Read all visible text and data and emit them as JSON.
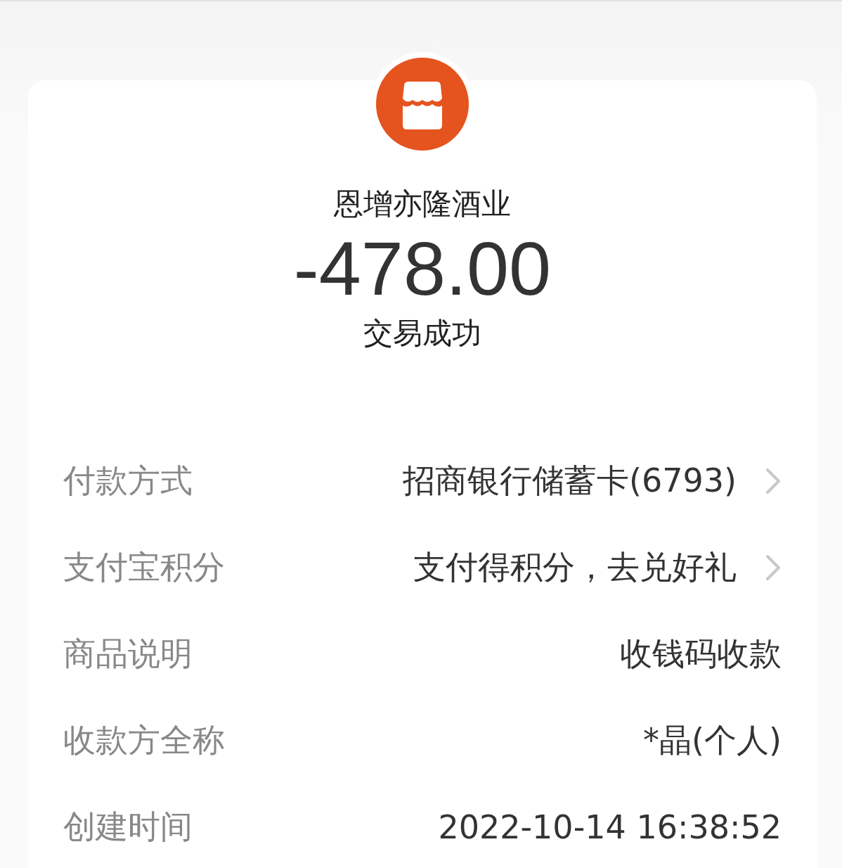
{
  "merchant": {
    "name": "恩增亦隆酒业",
    "amount": "-478.00",
    "status": "交易成功"
  },
  "details": [
    {
      "label": "付款方式",
      "value": "招商银行储蓄卡(6793)",
      "kind": "link"
    },
    {
      "label": "支付宝积分",
      "value": "支付得积分，去兑好礼",
      "kind": "link"
    },
    {
      "label": "商品说明",
      "value": "收钱码收款",
      "kind": "plain"
    },
    {
      "label": "收款方全称",
      "value": "*晶(个人)",
      "kind": "plain"
    },
    {
      "label": "创建时间",
      "value": "2022-10-14 16:38:52",
      "kind": "plain"
    }
  ]
}
